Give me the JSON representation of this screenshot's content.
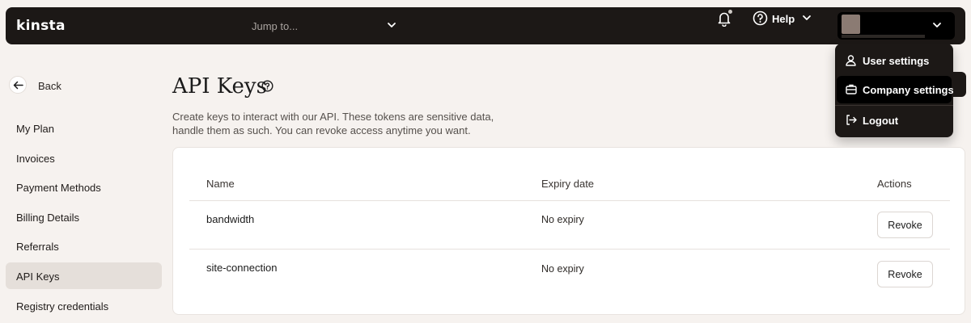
{
  "topbar": {
    "logo": "kinsta",
    "jump_placeholder": "Jump to...",
    "help_label": "Help"
  },
  "account_menu": {
    "items": [
      {
        "label": "User settings",
        "icon": "user-icon"
      },
      {
        "label": "Company settings",
        "icon": "briefcase-icon"
      },
      {
        "label": "Logout",
        "icon": "logout-icon"
      }
    ],
    "active_index": 1
  },
  "sidebar": {
    "back_label": "Back",
    "items": [
      {
        "label": "My Plan"
      },
      {
        "label": "Invoices"
      },
      {
        "label": "Payment Methods"
      },
      {
        "label": "Billing Details"
      },
      {
        "label": "Referrals"
      },
      {
        "label": "API Keys"
      },
      {
        "label": "Registry credentials"
      }
    ],
    "active_index": 5
  },
  "page": {
    "title": "API Keys",
    "description_line1": "Create keys to interact with our API. These tokens are sensitive data,",
    "description_line2": "handle them as such. You can revoke access anytime you want."
  },
  "table": {
    "columns": [
      "Name",
      "Expiry date",
      "Actions"
    ],
    "rows": [
      {
        "name": "bandwidth",
        "expiry": "No expiry",
        "action": "Revoke"
      },
      {
        "name": "site-connection",
        "expiry": "No expiry",
        "action": "Revoke"
      }
    ]
  },
  "colors": {
    "topbar_bg": "#1c1816",
    "page_bg": "#f6f2ef",
    "active_nav_bg": "#e5dfda"
  }
}
